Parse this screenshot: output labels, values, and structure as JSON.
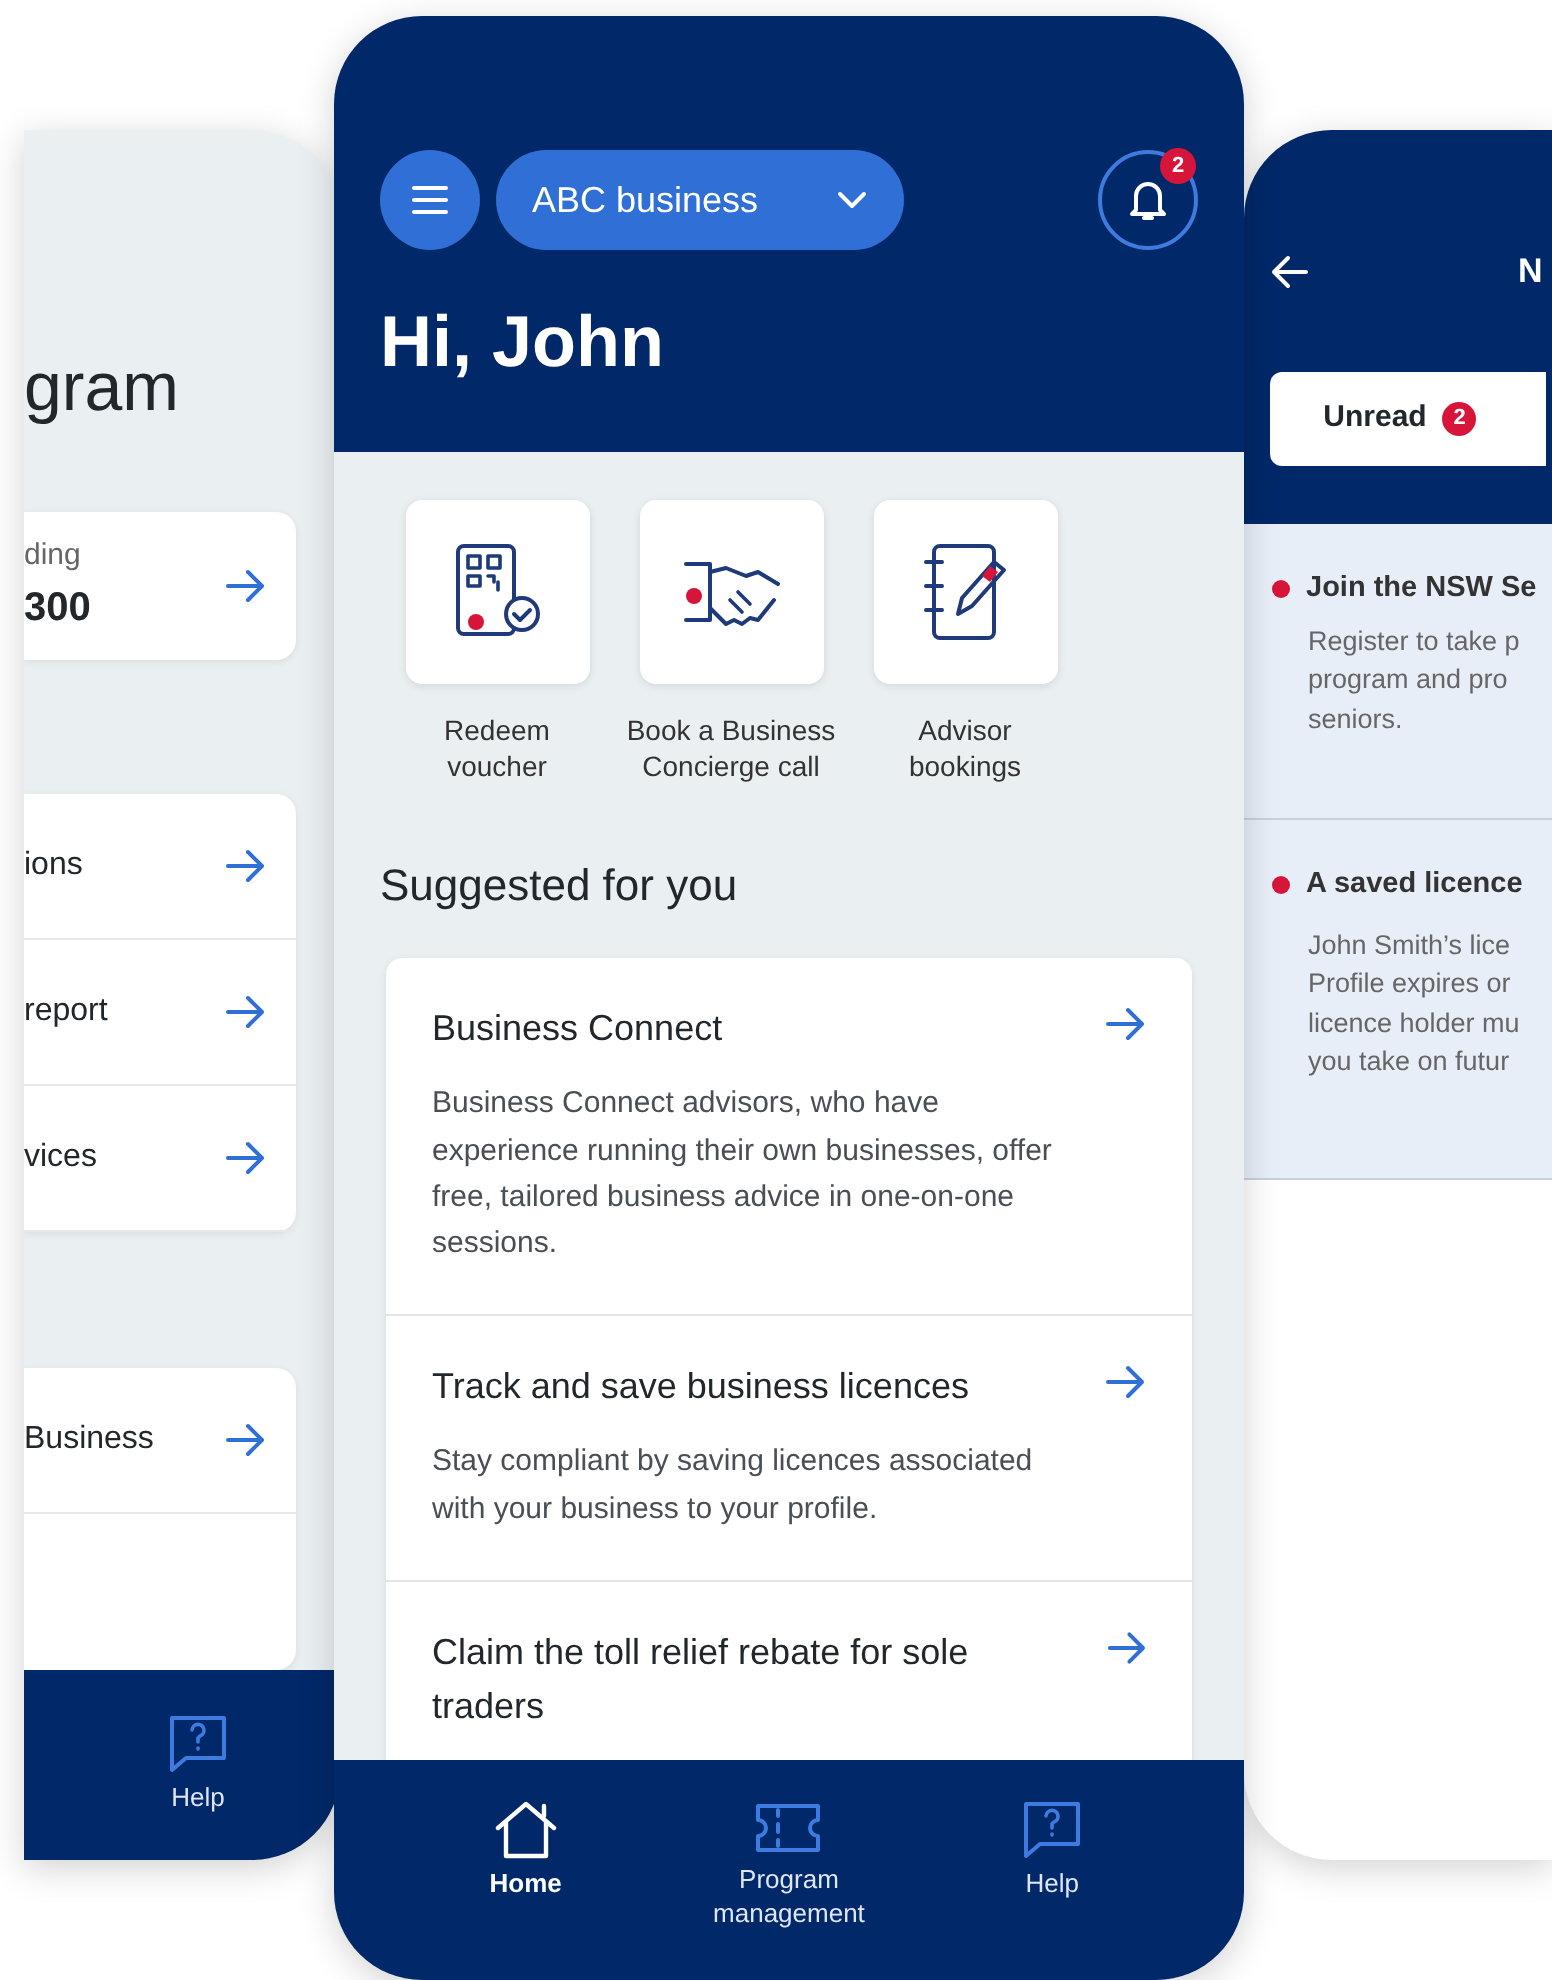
{
  "left_screen": {
    "title": "gram",
    "summary_card": {
      "label": "ding",
      "value": "300"
    },
    "link_groups": [
      [
        {
          "label": "ions"
        },
        {
          "label": "report"
        },
        {
          "label": "vices"
        }
      ],
      [
        {
          "label": "Business"
        }
      ]
    ],
    "bottom_nav": [
      {
        "label": "Help",
        "kind": "help",
        "selected": false
      }
    ]
  },
  "main_screen": {
    "business_selector": "ABC business",
    "notification_count": "2",
    "greeting": "Hi, John",
    "quick_actions": [
      {
        "label": "Redeem voucher",
        "kind": "voucher"
      },
      {
        "label": "Book a Business Concierge call",
        "kind": "handshake"
      },
      {
        "label": "Advisor bookings",
        "kind": "notebook"
      }
    ],
    "section_title": "Suggested for you",
    "suggestions": [
      {
        "title": "Business Connect",
        "description": "Business Connect advisors, who have experience running their own businesses, offer free, tailored business advice in one-on-one sessions."
      },
      {
        "title": "Track and save business licences",
        "description": "Stay compliant by saving licences associated with your business to your profile."
      },
      {
        "title": "Claim the toll relief rebate for sole traders"
      }
    ],
    "bottom_nav": [
      {
        "label": "Home",
        "kind": "home",
        "selected": true
      },
      {
        "label": "Program management",
        "kind": "ticket",
        "selected": false
      },
      {
        "label": "Help",
        "kind": "help",
        "selected": false
      }
    ]
  },
  "right_screen": {
    "title": "N",
    "tabs": [
      {
        "label": "Unread",
        "count": "2",
        "selected": true
      }
    ],
    "notifications": [
      {
        "unread": true,
        "title": "Join the NSW Se",
        "lines": [
          "Register to take p",
          "program and pro",
          "seniors."
        ]
      },
      {
        "unread": true,
        "title": "A saved licence",
        "lines": [
          "John Smith’s lice",
          "Profile expires or",
          "licence holder mu",
          "you take on futur"
        ]
      }
    ]
  }
}
